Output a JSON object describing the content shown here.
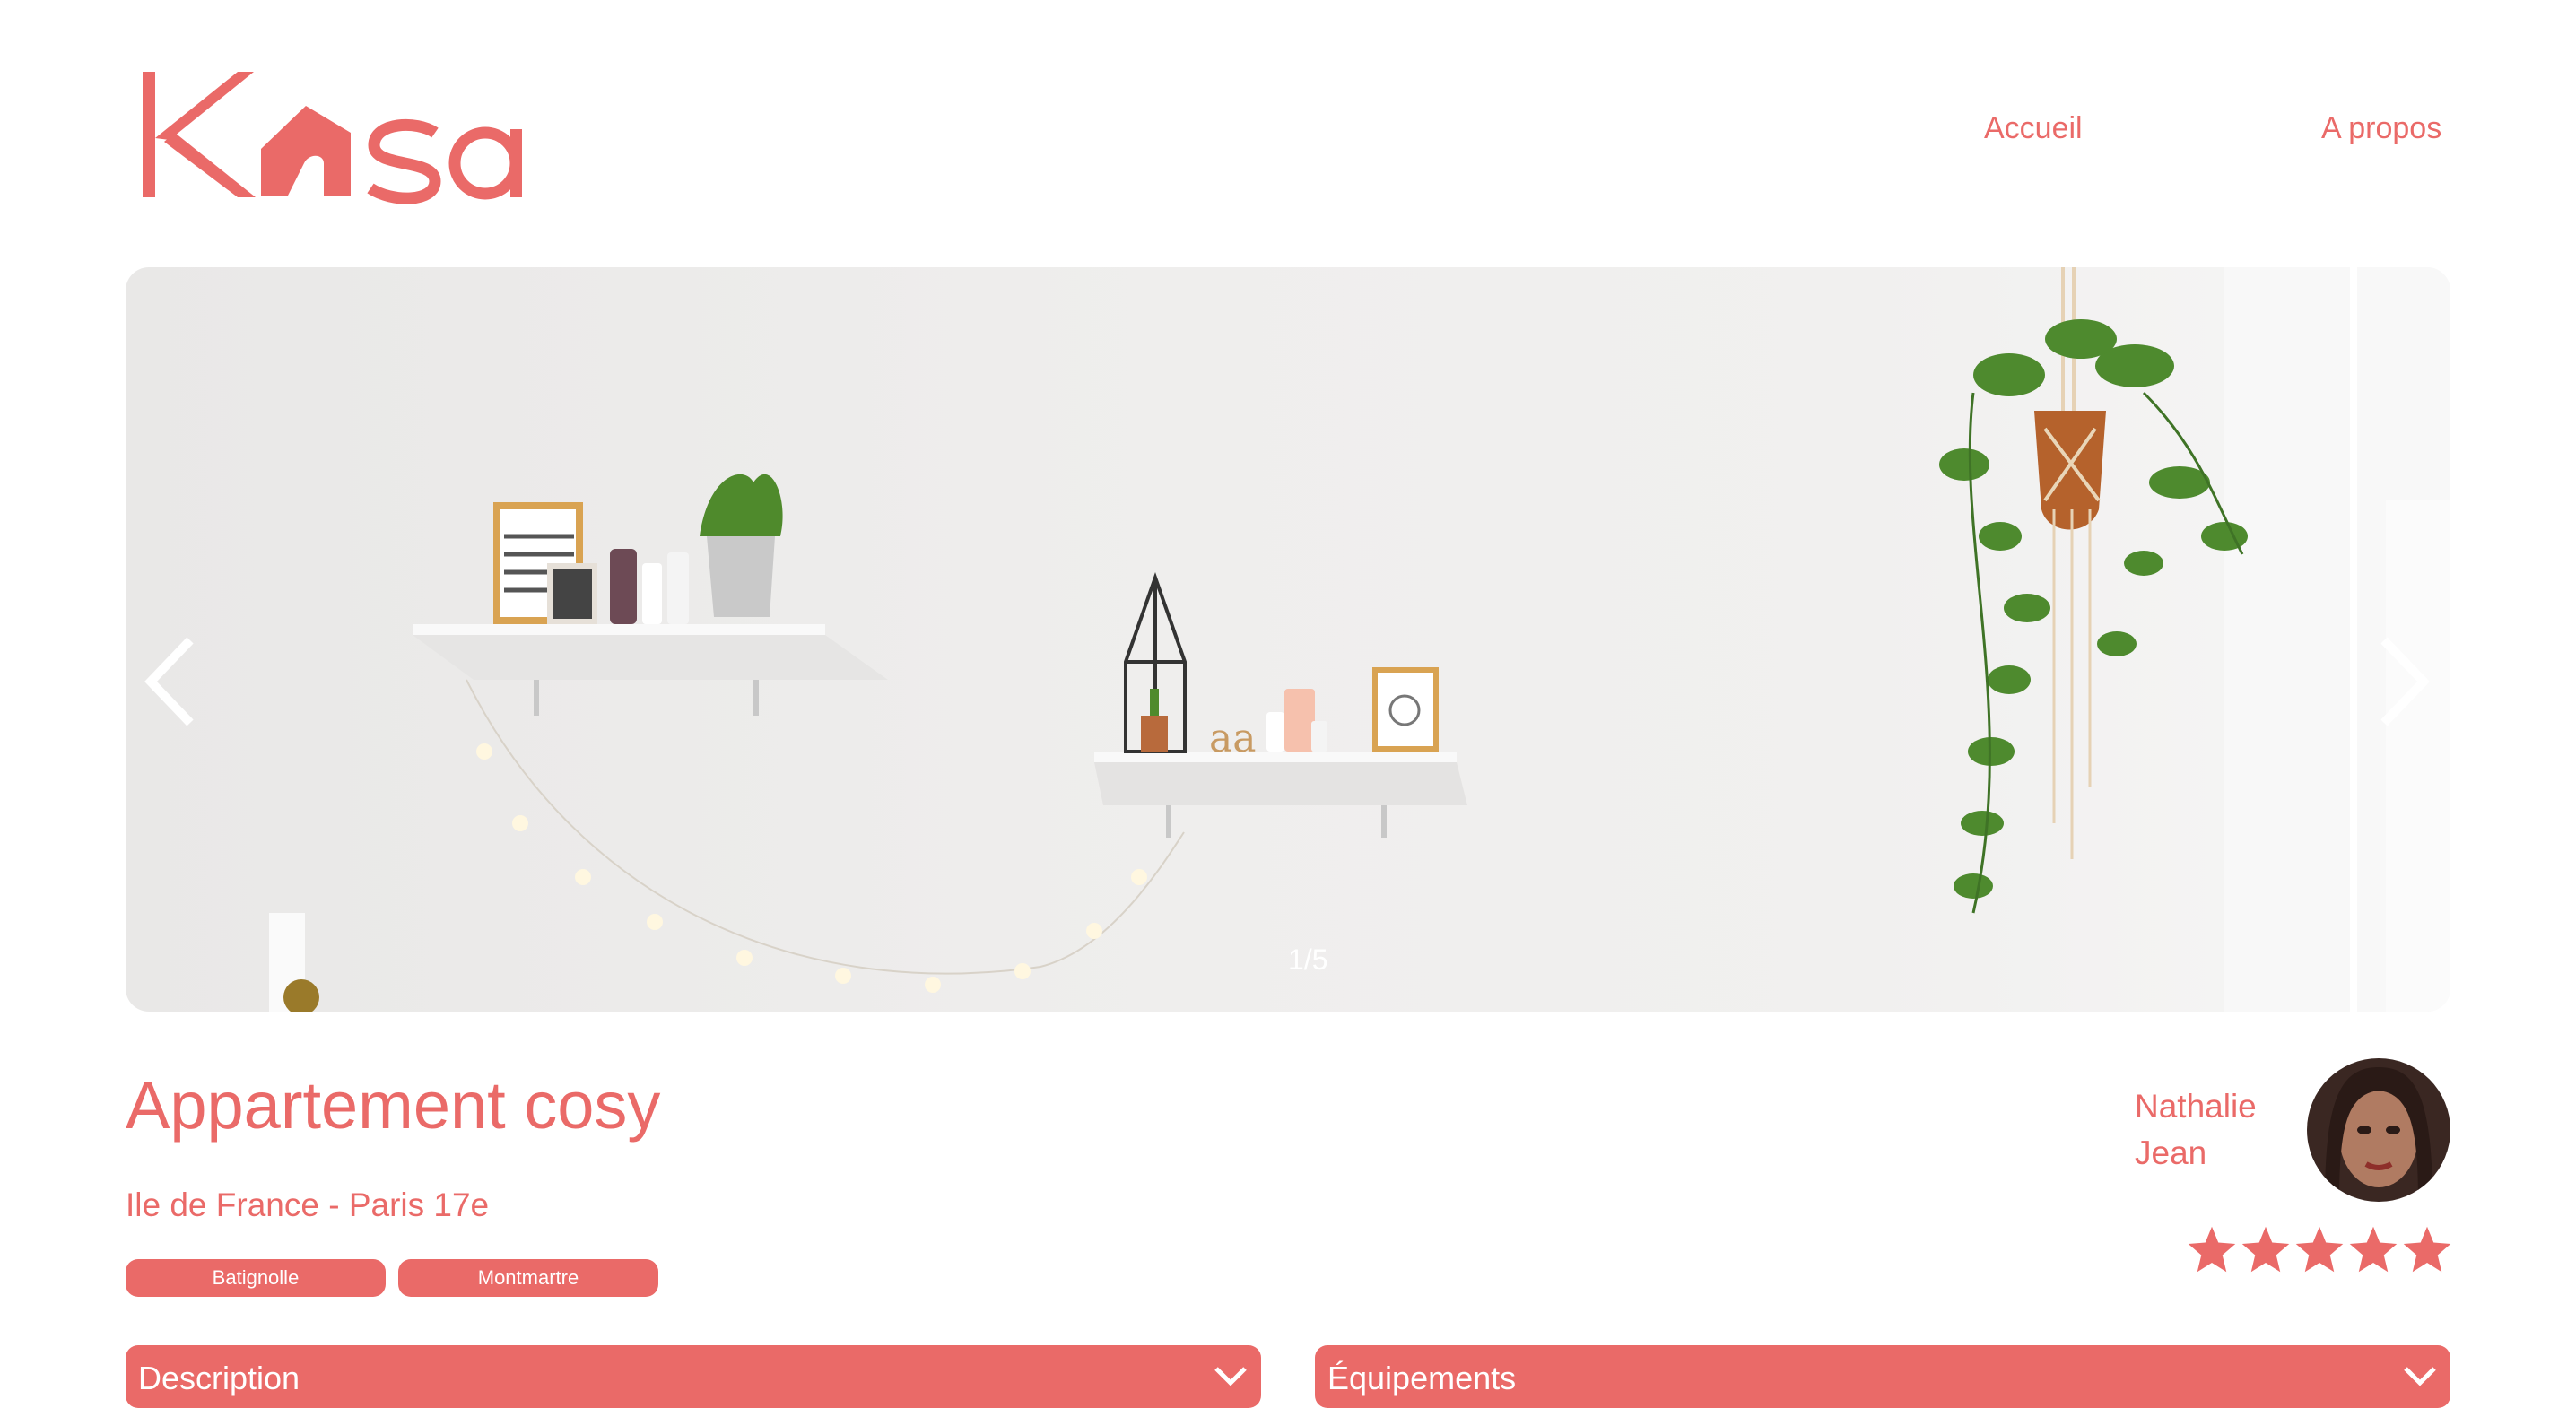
{
  "brand": {
    "logo_text": "Kasa",
    "accent": "#ea6a68"
  },
  "nav": {
    "home": "Accueil",
    "about": "A propos"
  },
  "carousel": {
    "counter": "1/5",
    "current": 1,
    "total": 5
  },
  "listing": {
    "title": "Appartement cosy",
    "location": "Ile de France - Paris 17e",
    "tags": [
      "Batignolle",
      "Montmartre"
    ]
  },
  "host": {
    "first_name": "Nathalie",
    "last_name": "Jean"
  },
  "rating": {
    "value": 5,
    "max": 5
  },
  "sections": {
    "description": "Description",
    "equipment": "Équipements"
  },
  "icons": {
    "prev": "chevron-left-icon",
    "next": "chevron-right-icon",
    "collapse": "chevron-down-icon",
    "star": "star-icon"
  }
}
